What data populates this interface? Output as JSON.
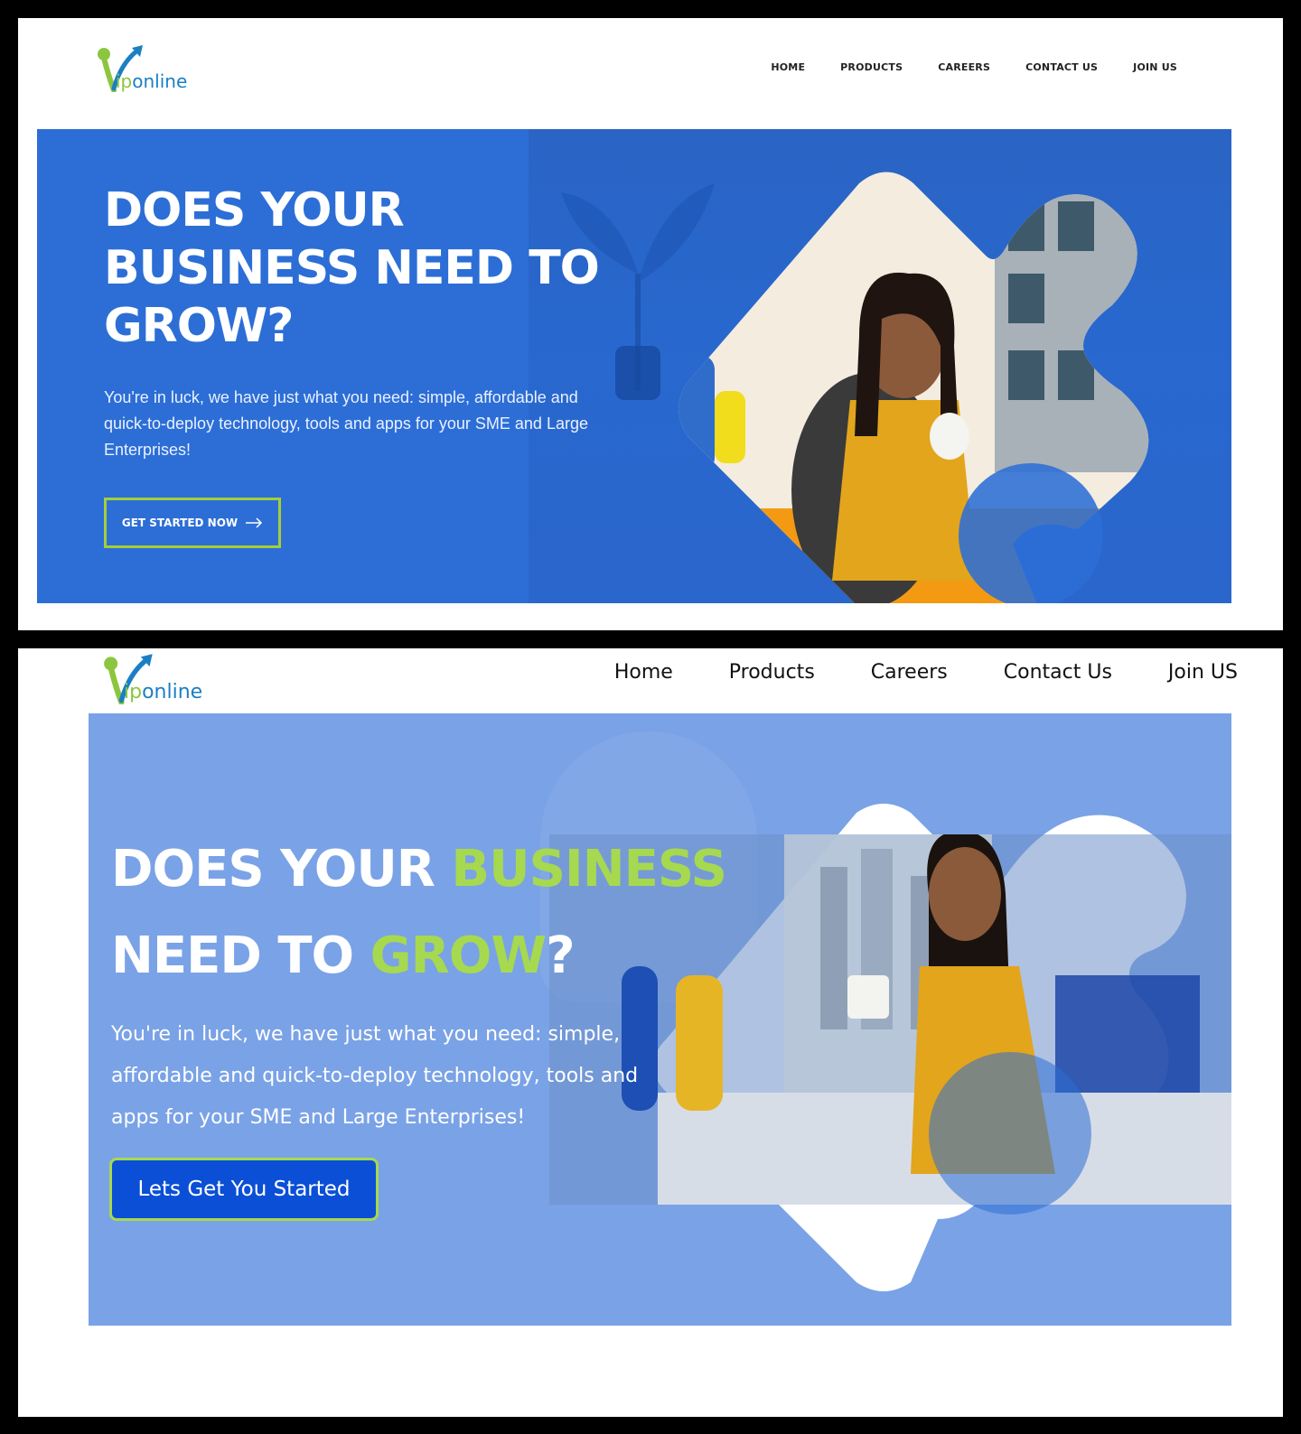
{
  "design_v1": {
    "logo": {
      "mark": "y",
      "text_green": "ip",
      "text_blue": "online"
    },
    "nav": [
      "HOME",
      "PRODUCTS",
      "CAREERS",
      "CONTACT US",
      "JOIN US"
    ],
    "hero": {
      "headline": "DOES YOUR BUSINESS NEED TO GROW?",
      "body": "You're in luck, we have just what you need: simple, affordable and quick-to-deploy technology, tools and apps for your SME and Large Enterprises!",
      "cta": "GET STARTED NOW"
    }
  },
  "design_v2": {
    "logo": {
      "mark": "y",
      "text_green": "ip",
      "text_blue": "online"
    },
    "nav": [
      "Home",
      "Products",
      "Careers",
      "Contact Us",
      "Join US"
    ],
    "hero": {
      "headline_part1": "DOES YOUR ",
      "headline_part2": "BUSINESS",
      "headline_part3": "NEED TO ",
      "headline_part4": "GROW",
      "headline_part5": "?",
      "body": "You're in luck, we have just what you need: simple, affordable and quick-to-deploy technology, tools and apps for your SME and Large Enterprises!",
      "cta": "Lets Get You Started"
    }
  },
  "colors": {
    "hero_v1": "#2c6ed6",
    "hero_v2": "#7aa2e6",
    "accent_green": "#a6d94f",
    "cta_v2": "#0b4fd6",
    "logo_green": "#8cc63f",
    "logo_blue": "#1b7fc4"
  },
  "icons": [
    "logo-icon",
    "arrow-right-icon",
    "hero-photo-graphic"
  ]
}
